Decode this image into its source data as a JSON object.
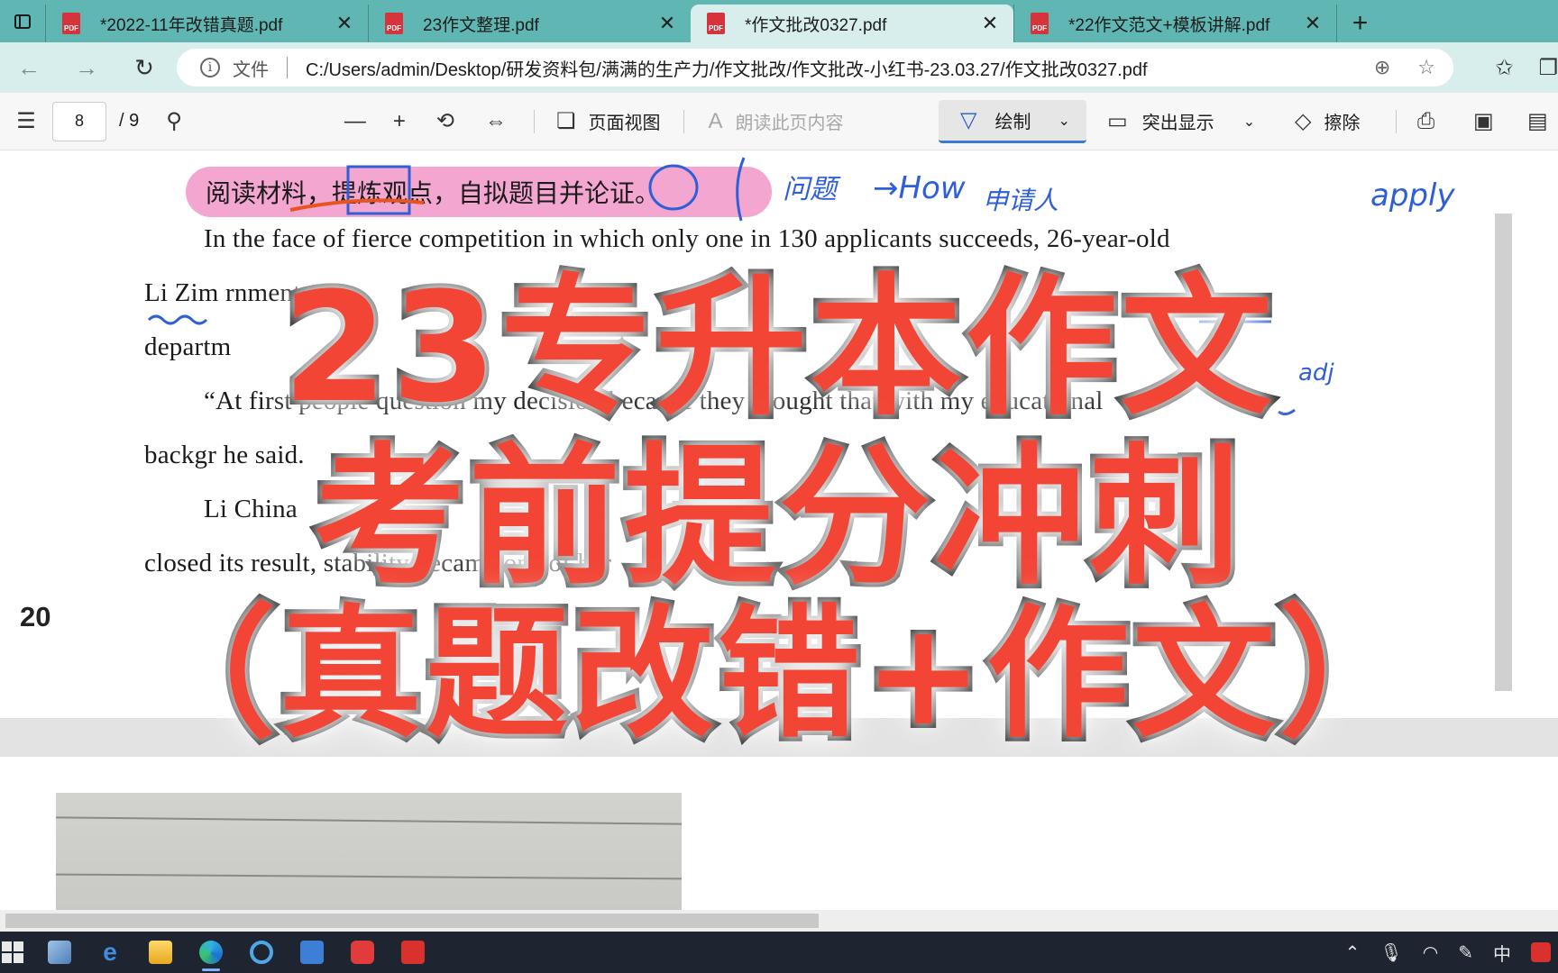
{
  "tabs": [
    {
      "label": "*2022-11年改错真题.pdf",
      "active": false
    },
    {
      "label": "23作文整理.pdf",
      "active": false
    },
    {
      "label": "*作文批改0327.pdf",
      "active": true
    },
    {
      "label": "*22作文范文+模板讲解.pdf",
      "active": false
    }
  ],
  "tab_icon_text": "PDF",
  "address": {
    "file_label": "文件",
    "url": "C:/Users/admin/Desktop/研发资料包/满满的生产力/作文批改/作文批改-小红书-23.03.27/作文批改0327.pdf"
  },
  "toolbar": {
    "page_current": "8",
    "page_total": "/ 9",
    "page_view_label": "页面视图",
    "read_aloud_label": "朗读此页内容",
    "draw_label": "绘制",
    "highlight_label": "突出显示",
    "erase_label": "擦除"
  },
  "document": {
    "prompt": "阅读材料，提炼观点，自拟题目并论证。",
    "lines": [
      "In the face of fierce competition in which only one in 130 applicants succeeds, 26-year-old",
      "Li Zim                                                                                       rnment",
      "departm",
      "“At first people question my decision because they thought that with my educational",
      "backgr                                                                              he said.",
      "Li                                                                                     China",
      "closed its                                                          result, stability became one of her"
    ],
    "annotations": [
      "问题",
      "→How",
      "申请人",
      "apply",
      "adj"
    ],
    "page_number": "20"
  },
  "overlay": {
    "line1": "23专升本作文",
    "line2": "考前提分冲刺",
    "line3": "（真题改错+作文）"
  },
  "taskbar": {
    "ime_label": "中"
  }
}
